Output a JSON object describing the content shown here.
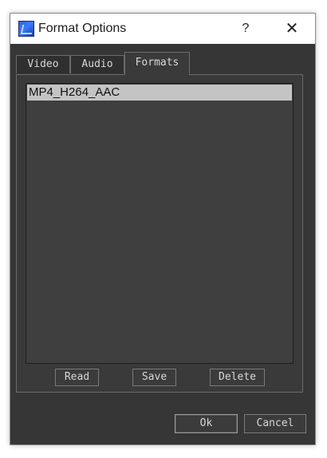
{
  "window": {
    "title": "Format Options",
    "help_label": "?",
    "close_label": "✕"
  },
  "tabs": [
    {
      "label": "Video"
    },
    {
      "label": "Audio"
    },
    {
      "label": "Formats",
      "active": true
    }
  ],
  "formats": {
    "items": [
      "MP4_H264_AAC"
    ],
    "selected_index": 0,
    "read_label": "Read",
    "save_label": "Save",
    "delete_label": "Delete"
  },
  "dialog": {
    "ok_label": "Ok",
    "cancel_label": "Cancel"
  },
  "colors": {
    "background": "#363636",
    "selection": "#c4c4c4",
    "text": "#d8d8d8"
  }
}
